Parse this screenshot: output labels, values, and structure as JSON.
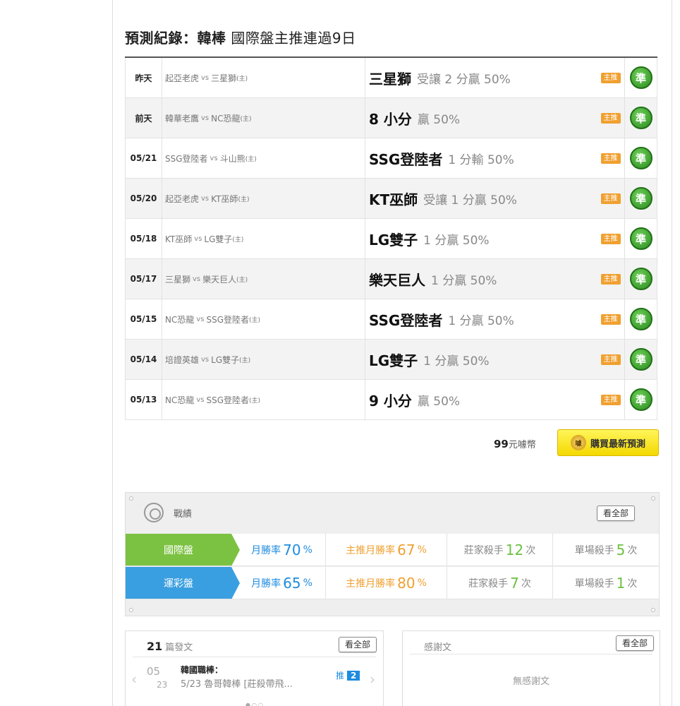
{
  "title": {
    "bold": "預測紀錄：韓棒",
    "rest": " 國際盤主推連過9日"
  },
  "predictions": [
    {
      "date": "昨天",
      "away": "起亞老虎",
      "vs": "vs",
      "home": "三星獅",
      "host": "(主)",
      "pick": "三星獅",
      "detail": "受讓 2 分贏 50%",
      "badge": "主推",
      "result": "準"
    },
    {
      "date": "前天",
      "away": "韓華老鷹",
      "vs": "vs",
      "home": "NC恐龍",
      "host": "(主)",
      "pick": "8 小分",
      "detail": "贏 50%",
      "badge": "主推",
      "result": "準"
    },
    {
      "date": "05/21",
      "away": "SSG登陸者",
      "vs": "vs",
      "home": "斗山熊",
      "host": "(主)",
      "pick": "SSG登陸者",
      "detail": "1 分輸 50%",
      "badge": "主推",
      "result": "準"
    },
    {
      "date": "05/20",
      "away": "起亞老虎",
      "vs": "vs",
      "home": "KT巫師",
      "host": "(主)",
      "pick": "KT巫師",
      "detail": "受讓 1 分贏 50%",
      "badge": "主推",
      "result": "準"
    },
    {
      "date": "05/18",
      "away": "KT巫師",
      "vs": "vs",
      "home": "LG雙子",
      "host": "(主)",
      "pick": "LG雙子",
      "detail": "1 分贏 50%",
      "badge": "主推",
      "result": "準"
    },
    {
      "date": "05/17",
      "away": "三星獅",
      "vs": "vs",
      "home": "樂天巨人",
      "host": "(主)",
      "pick": "樂天巨人",
      "detail": "1 分贏 50%",
      "badge": "主推",
      "result": "準"
    },
    {
      "date": "05/15",
      "away": "NC恐龍",
      "vs": "vs",
      "home": "SSG登陸者",
      "host": "(主)",
      "pick": "SSG登陸者",
      "detail": "1 分贏 50%",
      "badge": "主推",
      "result": "準"
    },
    {
      "date": "05/14",
      "away": "培證英雄",
      "vs": "vs",
      "home": "LG雙子",
      "host": "(主)",
      "pick": "LG雙子",
      "detail": "1 分贏 50%",
      "badge": "主推",
      "result": "準"
    },
    {
      "date": "05/13",
      "away": "NC恐龍",
      "vs": "vs",
      "home": "SSG登陸者",
      "host": "(主)",
      "pick": "9 小分",
      "detail": "贏 50%",
      "badge": "主推",
      "result": "準"
    }
  ],
  "purchase": {
    "price": "99",
    "unit": "元噱幣",
    "button": "購買最新預測",
    "coin": "噱"
  },
  "performance": {
    "title": "戰績",
    "view_all": "看全部",
    "rows": [
      {
        "label": "國際盤",
        "color": "#7cc242",
        "month_label": "月勝率",
        "month_value": "70",
        "month_unit": "%",
        "main_label": "主推月勝率",
        "main_value": "67",
        "main_unit": "%",
        "book_label": "莊家殺手",
        "book_value": "12",
        "book_unit": "次",
        "single_label": "單場殺手",
        "single_value": "5",
        "single_unit": "次"
      },
      {
        "label": "運彩盤",
        "color": "#3a9fe0",
        "month_label": "月勝率",
        "month_value": "65",
        "month_unit": "%",
        "main_label": "主推月勝率",
        "main_value": "80",
        "main_unit": "%",
        "book_label": "莊家殺手",
        "book_value": "7",
        "book_unit": "次",
        "single_label": "單場殺手",
        "single_value": "1",
        "single_unit": "次"
      }
    ]
  },
  "posts": {
    "count": "21",
    "count_label": "篇發文",
    "view_all": "看全部",
    "item": {
      "month": "05",
      "day": "23",
      "title": "韓國職棒：",
      "subtitle": "5/23 魯哥韓棒 [莊殺帶飛...",
      "push_label": "推",
      "push_count": "2"
    }
  },
  "thanks": {
    "title": "感謝文",
    "view_all": "看全部",
    "empty": "無感謝文"
  }
}
